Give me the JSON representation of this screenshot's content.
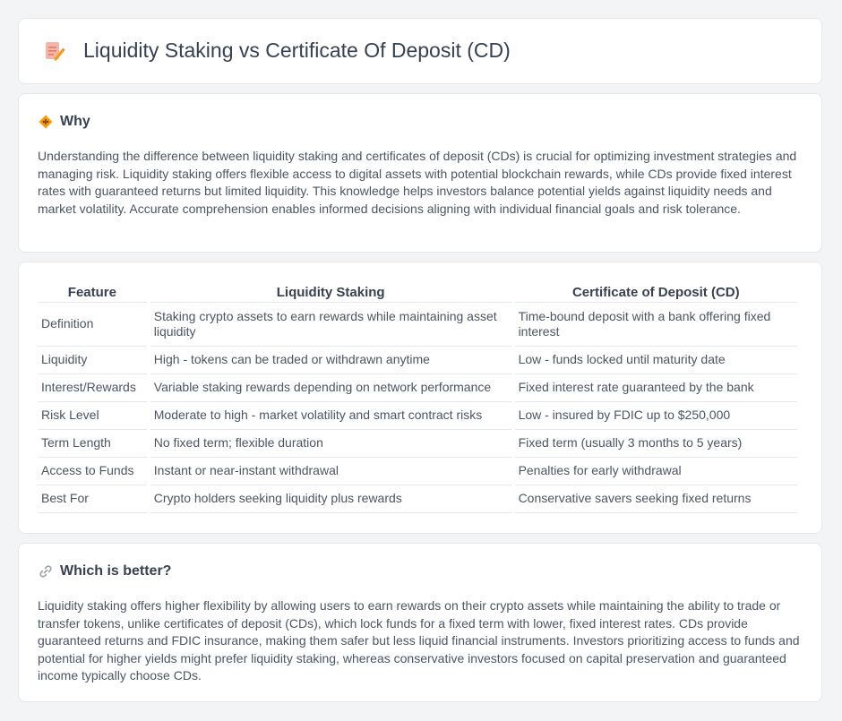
{
  "header": {
    "title": "Liquidity Staking vs Certificate Of Deposit (CD)",
    "icon": "document-pencil-icon"
  },
  "why": {
    "icon": "diamond-warning-icon",
    "heading": "Why",
    "body": "Understanding the difference between liquidity staking and certificates of deposit (CDs) is crucial for optimizing investment strategies and managing risk. Liquidity staking offers flexible access to digital assets with potential blockchain rewards, while CDs provide fixed interest rates with guaranteed returns but limited liquidity. This knowledge helps investors balance potential yields against liquidity needs and market volatility. Accurate comprehension enables informed decisions aligning with individual financial goals and risk tolerance."
  },
  "table": {
    "headers": [
      "Feature",
      "Liquidity Staking",
      "Certificate of Deposit (CD)"
    ],
    "rows": [
      [
        "Definition",
        "Staking crypto assets to earn rewards while maintaining asset liquidity",
        "Time-bound deposit with a bank offering fixed interest"
      ],
      [
        "Liquidity",
        "High - tokens can be traded or withdrawn anytime",
        "Low - funds locked until maturity date"
      ],
      [
        "Interest/Rewards",
        "Variable staking rewards depending on network performance",
        "Fixed interest rate guaranteed by the bank"
      ],
      [
        "Risk Level",
        "Moderate to high - market volatility and smart contract risks",
        "Low - insured by FDIC up to $250,000"
      ],
      [
        "Term Length",
        "No fixed term; flexible duration",
        "Fixed term (usually 3 months to 5 years)"
      ],
      [
        "Access to Funds",
        "Instant or near-instant withdrawal",
        "Penalties for early withdrawal"
      ],
      [
        "Best For",
        "Crypto holders seeking liquidity plus rewards",
        "Conservative savers seeking fixed returns"
      ]
    ]
  },
  "better": {
    "icon": "link-icon",
    "heading": "Which is better?",
    "body": "Liquidity staking offers higher flexibility by allowing users to earn rewards on their crypto assets while maintaining the ability to trade or transfer tokens, unlike certificates of deposit (CDs), which lock funds for a fixed term with lower, fixed interest rates. CDs provide guaranteed returns and FDIC insurance, making them safer but less liquid financial instruments. Investors prioritizing access to funds and potential for higher yields might prefer liquidity staking, whereas conservative investors focused on capital preservation and guaranteed income typically choose CDs."
  }
}
